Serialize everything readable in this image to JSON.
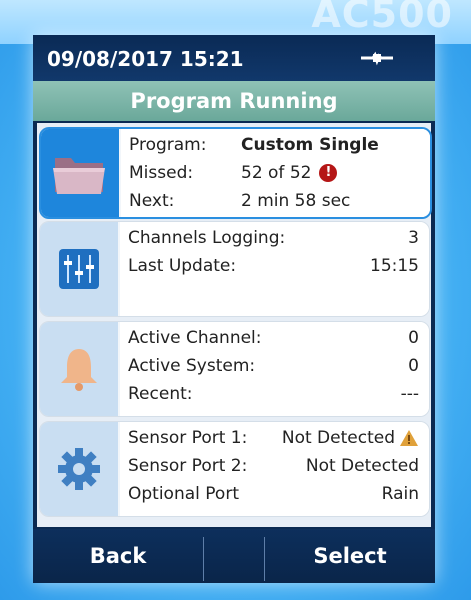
{
  "top_glare_text": "AC500",
  "status": {
    "datetime": "09/08/2017 15:21",
    "power_icon": "plug-icon"
  },
  "header": {
    "title": "Program Running"
  },
  "program_card": {
    "icon": "folder-icon",
    "program_label": "Program:",
    "program_value": "Custom Single",
    "missed_label": "Missed:",
    "missed_value": "52 of 52",
    "missed_alert": "!",
    "next_label": "Next:",
    "next_value": "2 min 58 sec"
  },
  "logging_card": {
    "icon": "sliders-icon",
    "channels_label": "Channels Logging:",
    "channels_value": "3",
    "update_label": "Last Update:",
    "update_value": "15:15"
  },
  "alarm_card": {
    "icon": "bell-icon",
    "active_channel_label": "Active Channel:",
    "active_channel_value": "0",
    "active_system_label": "Active System:",
    "active_system_value": "0",
    "recent_label": "Recent:",
    "recent_value": "---"
  },
  "sensor_card": {
    "icon": "gear-icon",
    "port1_label": "Sensor Port 1:",
    "port1_value": "Not Detected",
    "port2_label": "Sensor Port 2:",
    "port2_value": "Not Detected",
    "optional_label": "Optional Port",
    "optional_value": "Rain"
  },
  "footer": {
    "back_label": "Back",
    "select_label": "Select"
  },
  "colors": {
    "accent": "#1e86dc",
    "header": "#6aa89a",
    "device_frame": "#0b2a52",
    "alert": "#b51616",
    "warning": "#e0a13a"
  }
}
